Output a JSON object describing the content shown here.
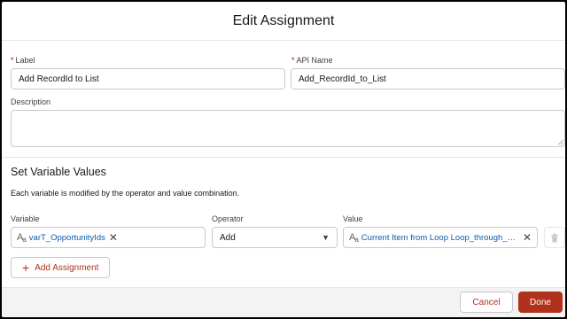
{
  "modal": {
    "title": "Edit Assignment"
  },
  "form": {
    "label": {
      "text": "Label",
      "value": "Add RecordId to List"
    },
    "api_name": {
      "text": "API Name",
      "value": "Add_RecordId_to_List"
    },
    "description": {
      "text": "Description",
      "value": ""
    }
  },
  "variables": {
    "section_title": "Set Variable Values",
    "helptext": "Each variable is modified by the operator and value combination.",
    "col_variable": "Variable",
    "col_operator": "Operator",
    "col_value": "Value",
    "rows": [
      {
        "variable": "varT_OpportunityIds",
        "operator": "Add",
        "value": "Current Item from Loop Loop_through_Opportunities"
      }
    ],
    "add_label": "Add Assignment"
  },
  "footer": {
    "cancel_label": "Cancel",
    "done_label": "Done"
  },
  "colors": {
    "brand": "#b0321c",
    "link": "#0b5cab",
    "required": "#ba0517",
    "border": "#c9c9c9"
  },
  "icons": [
    "text-type-icon",
    "clear-icon",
    "chevron-down-icon",
    "trash-icon",
    "add-icon",
    "resize-grip-icon"
  ]
}
